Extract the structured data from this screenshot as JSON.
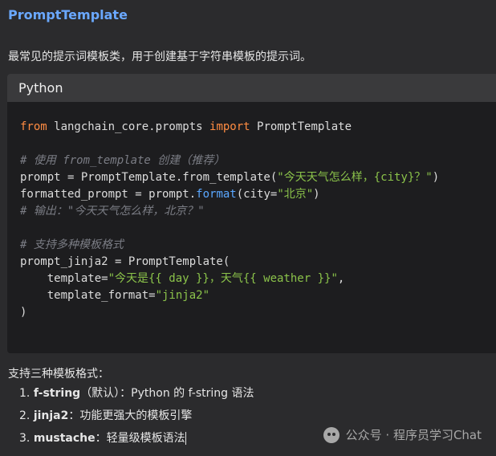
{
  "doc": {
    "title": "PromptTemplate",
    "intro": "最常见的提示词模板类，用于创建基于字符串模板的提示词。",
    "code": {
      "lang_label": "Python",
      "line1": {
        "kw1": "from",
        "mod": " langchain_core.prompts ",
        "kw2": "import",
        "cls": " PromptTemplate"
      },
      "cmt1": "# 使用 from_template 创建（推荐）",
      "line3": {
        "a": "prompt = PromptTemplate.from_template(",
        "s": "\"今天天气怎么样，{city}？\"",
        "b": ")"
      },
      "line4": {
        "a": "formatted_prompt = prompt.",
        "fn": "format",
        "b": "(city=",
        "s": "\"北京\"",
        "c": ")"
      },
      "cmt2": "# 输出：\"今天天气怎么样，北京？\"",
      "cmt3": "# 支持多种模板格式",
      "line7": "prompt_jinja2 = PromptTemplate(",
      "line8": {
        "a": "    template=",
        "s": "\"今天是{{ day }}，天气{{ weather }}\"",
        "b": ","
      },
      "line9": {
        "a": "    template_format=",
        "s": "\"jinja2\""
      },
      "line10": ")"
    },
    "section_title": "支持三种模板格式：",
    "items": [
      {
        "num": "1.",
        "name": "f-string",
        "desc": "（默认）：Python 的 f-string 语法"
      },
      {
        "num": "2.",
        "name": "jinja2",
        "desc": "：功能更强大的模板引擎"
      },
      {
        "num": "3.",
        "name": "mustache",
        "desc": "：轻量级模板语法"
      }
    ]
  },
  "watermark": {
    "text": "公众号 · 程序员学习Chat"
  }
}
